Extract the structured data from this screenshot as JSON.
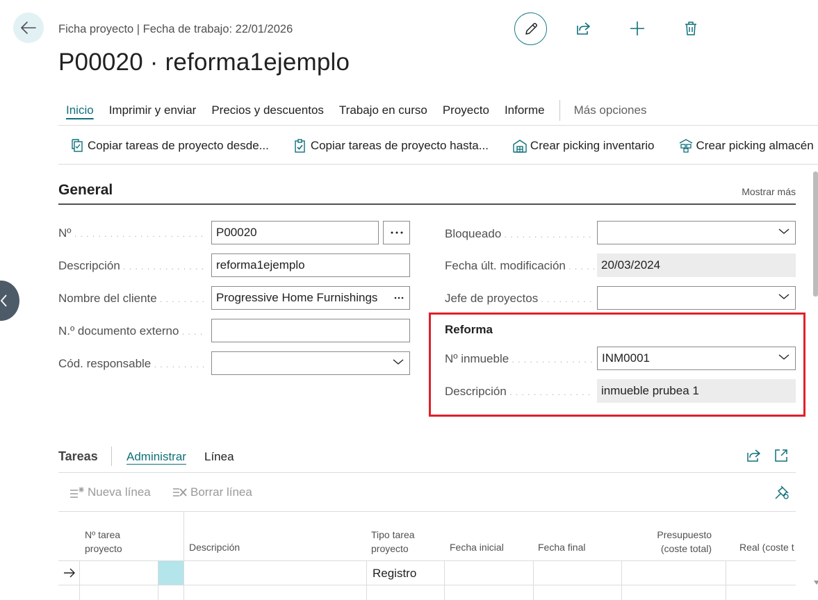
{
  "header": {
    "breadcrumb": "Ficha proyecto | Fecha de trabajo: 22/01/2026",
    "title": "P00020 · reforma1ejemplo"
  },
  "tabs": [
    {
      "label": "Inicio"
    },
    {
      "label": "Imprimir y enviar"
    },
    {
      "label": "Precios y descuentos"
    },
    {
      "label": "Trabajo en curso"
    },
    {
      "label": "Proyecto"
    },
    {
      "label": "Informe"
    }
  ],
  "tabs_more": "Más opciones",
  "actions": [
    {
      "label": "Copiar tareas de proyecto desde..."
    },
    {
      "label": "Copiar tareas de proyecto hasta..."
    },
    {
      "label": "Crear picking inventario"
    },
    {
      "label": "Crear picking almacén"
    }
  ],
  "general": {
    "title": "General",
    "show_more": "Mostrar más",
    "left_fields": [
      {
        "label": "Nº",
        "value": "P00020"
      },
      {
        "label": "Descripción",
        "value": "reforma1ejemplo"
      },
      {
        "label": "Nombre del cliente",
        "value": "Progressive Home Furnishings"
      },
      {
        "label": "N.º documento externo",
        "value": ""
      },
      {
        "label": "Cód. responsable",
        "value": ""
      }
    ],
    "right_fields": [
      {
        "label": "Bloqueado",
        "value": ""
      },
      {
        "label": "Fecha últ. modificación",
        "value": "20/03/2024"
      },
      {
        "label": "Jefe de proyectos",
        "value": ""
      }
    ],
    "reforma": {
      "title": "Reforma",
      "fields": [
        {
          "label": "Nº inmueble",
          "value": "INM0001"
        },
        {
          "label": "Descripción",
          "value": "inmueble prubea 1"
        }
      ]
    }
  },
  "tareas": {
    "title": "Tareas",
    "tabs": [
      "Administrar",
      "Línea"
    ],
    "actions": [
      "Nueva línea",
      "Borrar línea"
    ],
    "columns": [
      {
        "line1": "Nº tarea",
        "line2": "proyecto"
      },
      {
        "line1": "Descripción",
        "line2": ""
      },
      {
        "line1": "Tipo tarea",
        "line2": "proyecto"
      },
      {
        "line1": "Fecha inicial",
        "line2": ""
      },
      {
        "line1": "Fecha final",
        "line2": ""
      },
      {
        "line1": "Presupuesto",
        "line2": "(coste total)"
      },
      {
        "line1": "Real (coste t",
        "line2": ""
      }
    ],
    "rows": [
      {
        "tipo": "Registro"
      }
    ]
  },
  "colors": {
    "accent": "#0f6f7a",
    "highlight": "#e0202a",
    "selected_cell": "#b3e5ea"
  }
}
